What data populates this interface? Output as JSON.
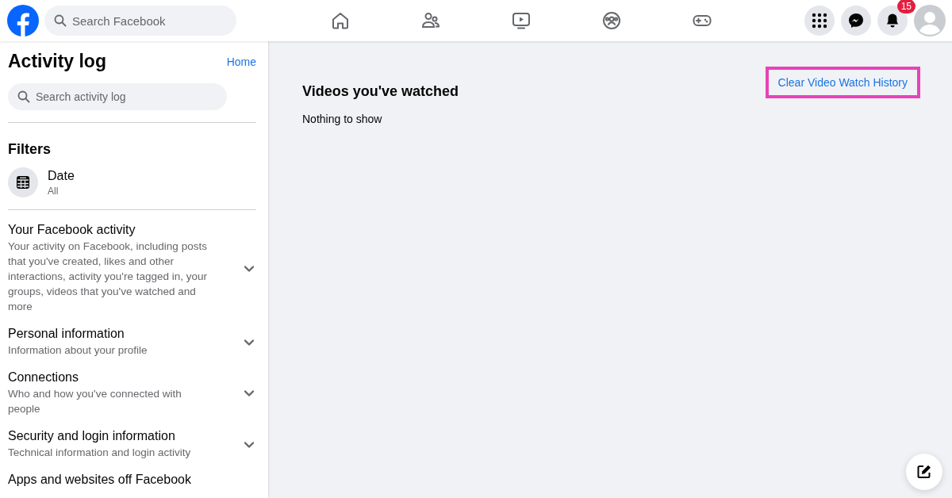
{
  "topbar": {
    "search": {
      "placeholder": "Search Facebook"
    },
    "nav": [
      {
        "kind": "home"
      },
      {
        "kind": "friends"
      },
      {
        "kind": "video"
      },
      {
        "kind": "groups"
      },
      {
        "kind": "gaming"
      }
    ],
    "actions": [
      {
        "kind": "menu"
      },
      {
        "kind": "messenger"
      },
      {
        "kind": "notifications",
        "badge": "15"
      },
      {
        "kind": "profile"
      }
    ]
  },
  "sidebar": {
    "title": "Activity log",
    "home_link": "Home",
    "search": {
      "placeholder": "Search activity log"
    },
    "filters_title": "Filters",
    "filters": [
      {
        "label": "Date",
        "value": "All"
      }
    ],
    "categories": [
      {
        "title": "Your Facebook activity",
        "description": "Your activity on Facebook, including posts that you've created, likes and other interactions, activity you're tagged in, your groups, videos that you've watched and more",
        "expanded": false
      },
      {
        "title": "Personal information",
        "description": "Information about your profile",
        "expanded": false
      },
      {
        "title": "Connections",
        "description": "Who and how you've connected with people",
        "expanded": false
      },
      {
        "title": "Security and login information",
        "description": "Technical information and login activity",
        "expanded": false
      },
      {
        "title": "Apps and websites off Facebook"
      }
    ]
  },
  "main": {
    "title": "Videos you've watched",
    "empty_text": "Nothing to show",
    "action": {
      "label": "Clear Video Watch History",
      "highlighted": true
    }
  }
}
